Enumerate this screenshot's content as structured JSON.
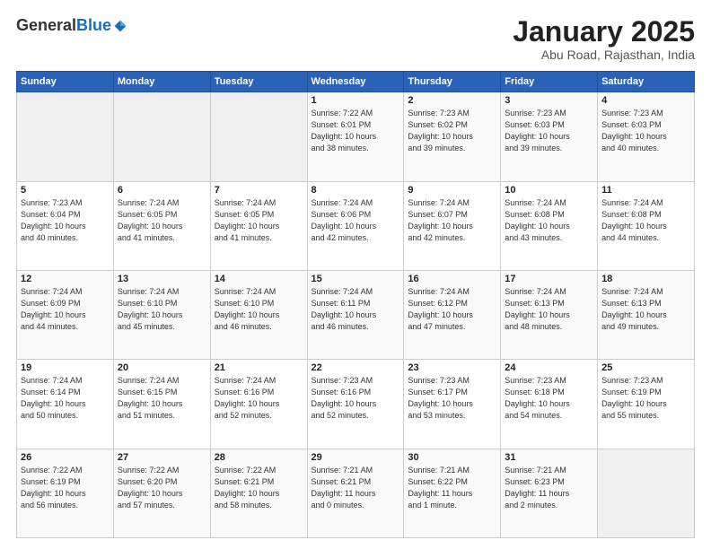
{
  "logo": {
    "general": "General",
    "blue": "Blue"
  },
  "header": {
    "month": "January 2025",
    "location": "Abu Road, Rajasthan, India"
  },
  "days_of_week": [
    "Sunday",
    "Monday",
    "Tuesday",
    "Wednesday",
    "Thursday",
    "Friday",
    "Saturday"
  ],
  "weeks": [
    [
      {
        "day": "",
        "info": ""
      },
      {
        "day": "",
        "info": ""
      },
      {
        "day": "",
        "info": ""
      },
      {
        "day": "1",
        "info": "Sunrise: 7:22 AM\nSunset: 6:01 PM\nDaylight: 10 hours\nand 38 minutes."
      },
      {
        "day": "2",
        "info": "Sunrise: 7:23 AM\nSunset: 6:02 PM\nDaylight: 10 hours\nand 39 minutes."
      },
      {
        "day": "3",
        "info": "Sunrise: 7:23 AM\nSunset: 6:03 PM\nDaylight: 10 hours\nand 39 minutes."
      },
      {
        "day": "4",
        "info": "Sunrise: 7:23 AM\nSunset: 6:03 PM\nDaylight: 10 hours\nand 40 minutes."
      }
    ],
    [
      {
        "day": "5",
        "info": "Sunrise: 7:23 AM\nSunset: 6:04 PM\nDaylight: 10 hours\nand 40 minutes."
      },
      {
        "day": "6",
        "info": "Sunrise: 7:24 AM\nSunset: 6:05 PM\nDaylight: 10 hours\nand 41 minutes."
      },
      {
        "day": "7",
        "info": "Sunrise: 7:24 AM\nSunset: 6:05 PM\nDaylight: 10 hours\nand 41 minutes."
      },
      {
        "day": "8",
        "info": "Sunrise: 7:24 AM\nSunset: 6:06 PM\nDaylight: 10 hours\nand 42 minutes."
      },
      {
        "day": "9",
        "info": "Sunrise: 7:24 AM\nSunset: 6:07 PM\nDaylight: 10 hours\nand 42 minutes."
      },
      {
        "day": "10",
        "info": "Sunrise: 7:24 AM\nSunset: 6:08 PM\nDaylight: 10 hours\nand 43 minutes."
      },
      {
        "day": "11",
        "info": "Sunrise: 7:24 AM\nSunset: 6:08 PM\nDaylight: 10 hours\nand 44 minutes."
      }
    ],
    [
      {
        "day": "12",
        "info": "Sunrise: 7:24 AM\nSunset: 6:09 PM\nDaylight: 10 hours\nand 44 minutes."
      },
      {
        "day": "13",
        "info": "Sunrise: 7:24 AM\nSunset: 6:10 PM\nDaylight: 10 hours\nand 45 minutes."
      },
      {
        "day": "14",
        "info": "Sunrise: 7:24 AM\nSunset: 6:10 PM\nDaylight: 10 hours\nand 46 minutes."
      },
      {
        "day": "15",
        "info": "Sunrise: 7:24 AM\nSunset: 6:11 PM\nDaylight: 10 hours\nand 46 minutes."
      },
      {
        "day": "16",
        "info": "Sunrise: 7:24 AM\nSunset: 6:12 PM\nDaylight: 10 hours\nand 47 minutes."
      },
      {
        "day": "17",
        "info": "Sunrise: 7:24 AM\nSunset: 6:13 PM\nDaylight: 10 hours\nand 48 minutes."
      },
      {
        "day": "18",
        "info": "Sunrise: 7:24 AM\nSunset: 6:13 PM\nDaylight: 10 hours\nand 49 minutes."
      }
    ],
    [
      {
        "day": "19",
        "info": "Sunrise: 7:24 AM\nSunset: 6:14 PM\nDaylight: 10 hours\nand 50 minutes."
      },
      {
        "day": "20",
        "info": "Sunrise: 7:24 AM\nSunset: 6:15 PM\nDaylight: 10 hours\nand 51 minutes."
      },
      {
        "day": "21",
        "info": "Sunrise: 7:24 AM\nSunset: 6:16 PM\nDaylight: 10 hours\nand 52 minutes."
      },
      {
        "day": "22",
        "info": "Sunrise: 7:23 AM\nSunset: 6:16 PM\nDaylight: 10 hours\nand 52 minutes."
      },
      {
        "day": "23",
        "info": "Sunrise: 7:23 AM\nSunset: 6:17 PM\nDaylight: 10 hours\nand 53 minutes."
      },
      {
        "day": "24",
        "info": "Sunrise: 7:23 AM\nSunset: 6:18 PM\nDaylight: 10 hours\nand 54 minutes."
      },
      {
        "day": "25",
        "info": "Sunrise: 7:23 AM\nSunset: 6:19 PM\nDaylight: 10 hours\nand 55 minutes."
      }
    ],
    [
      {
        "day": "26",
        "info": "Sunrise: 7:22 AM\nSunset: 6:19 PM\nDaylight: 10 hours\nand 56 minutes."
      },
      {
        "day": "27",
        "info": "Sunrise: 7:22 AM\nSunset: 6:20 PM\nDaylight: 10 hours\nand 57 minutes."
      },
      {
        "day": "28",
        "info": "Sunrise: 7:22 AM\nSunset: 6:21 PM\nDaylight: 10 hours\nand 58 minutes."
      },
      {
        "day": "29",
        "info": "Sunrise: 7:21 AM\nSunset: 6:21 PM\nDaylight: 11 hours\nand 0 minutes."
      },
      {
        "day": "30",
        "info": "Sunrise: 7:21 AM\nSunset: 6:22 PM\nDaylight: 11 hours\nand 1 minute."
      },
      {
        "day": "31",
        "info": "Sunrise: 7:21 AM\nSunset: 6:23 PM\nDaylight: 11 hours\nand 2 minutes."
      },
      {
        "day": "",
        "info": ""
      }
    ]
  ]
}
